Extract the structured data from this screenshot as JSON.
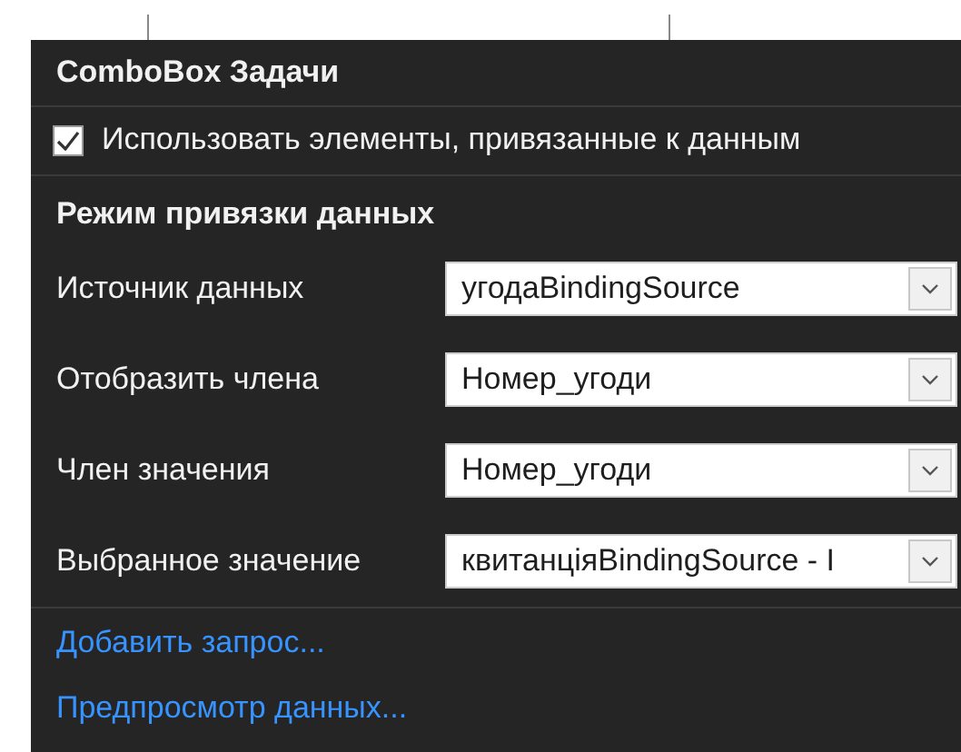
{
  "panel": {
    "title": "ComboBox Задачи",
    "checkbox": {
      "label": "Использовать элементы, привязанные к данным",
      "checked": true
    },
    "section": "Режим привязки данных",
    "fields": [
      {
        "label": "Источник данных",
        "value": "угодаBindingSource"
      },
      {
        "label": "Отобразить члена",
        "value": "Номер_угоди"
      },
      {
        "label": "Член значения",
        "value": "Номер_угоди"
      },
      {
        "label": "Выбранное значение",
        "value": "квитанціяBindingSource - I"
      }
    ],
    "links": [
      "Добавить запрос...",
      "Предпросмотр данных..."
    ]
  }
}
